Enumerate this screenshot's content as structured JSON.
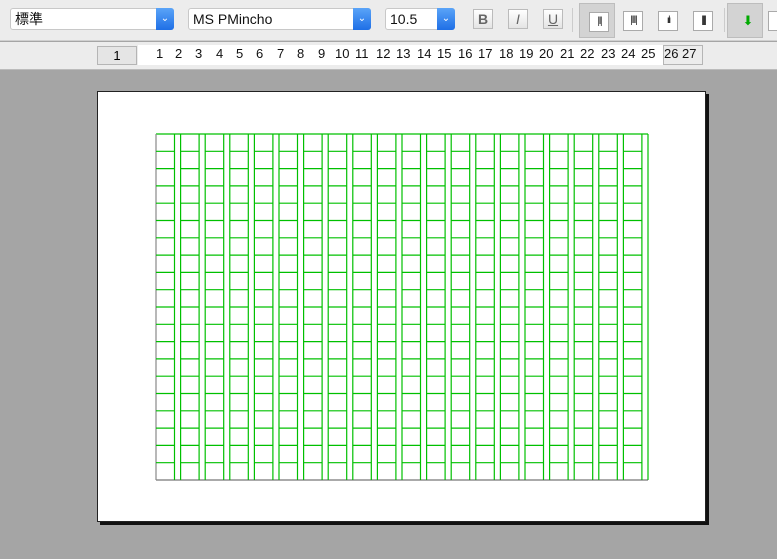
{
  "toolbar": {
    "style": "標準",
    "font": "MS PMincho",
    "size": "10.5",
    "bold": "B",
    "italic": "I",
    "underline": "U"
  },
  "ruler": {
    "current_page": "1",
    "columns": [
      "1",
      "2",
      "3",
      "4",
      "5",
      "6",
      "7",
      "8",
      "9",
      "10",
      "11",
      "12",
      "13",
      "14",
      "15",
      "16",
      "17",
      "18",
      "19",
      "20",
      "21",
      "22",
      "23",
      "24",
      "25",
      "26",
      "27"
    ]
  },
  "grid": {
    "columns": 20,
    "rows": 20,
    "line_color": "#00c000"
  }
}
